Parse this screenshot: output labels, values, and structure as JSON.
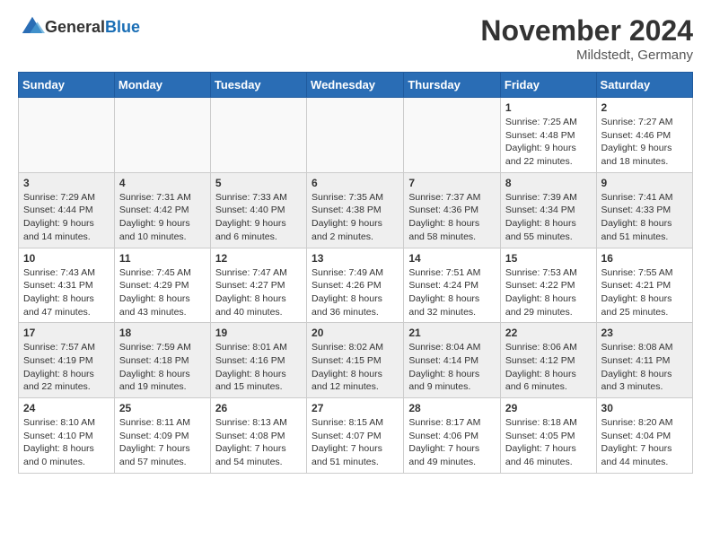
{
  "logo": {
    "general": "General",
    "blue": "Blue"
  },
  "title": "November 2024",
  "subtitle": "Mildstedt, Germany",
  "headers": [
    "Sunday",
    "Monday",
    "Tuesday",
    "Wednesday",
    "Thursday",
    "Friday",
    "Saturday"
  ],
  "weeks": [
    {
      "days": [
        {
          "num": "",
          "info": ""
        },
        {
          "num": "",
          "info": ""
        },
        {
          "num": "",
          "info": ""
        },
        {
          "num": "",
          "info": ""
        },
        {
          "num": "",
          "info": ""
        },
        {
          "num": "1",
          "info": "Sunrise: 7:25 AM\nSunset: 4:48 PM\nDaylight: 9 hours\nand 22 minutes."
        },
        {
          "num": "2",
          "info": "Sunrise: 7:27 AM\nSunset: 4:46 PM\nDaylight: 9 hours\nand 18 minutes."
        }
      ]
    },
    {
      "days": [
        {
          "num": "3",
          "info": "Sunrise: 7:29 AM\nSunset: 4:44 PM\nDaylight: 9 hours\nand 14 minutes."
        },
        {
          "num": "4",
          "info": "Sunrise: 7:31 AM\nSunset: 4:42 PM\nDaylight: 9 hours\nand 10 minutes."
        },
        {
          "num": "5",
          "info": "Sunrise: 7:33 AM\nSunset: 4:40 PM\nDaylight: 9 hours\nand 6 minutes."
        },
        {
          "num": "6",
          "info": "Sunrise: 7:35 AM\nSunset: 4:38 PM\nDaylight: 9 hours\nand 2 minutes."
        },
        {
          "num": "7",
          "info": "Sunrise: 7:37 AM\nSunset: 4:36 PM\nDaylight: 8 hours\nand 58 minutes."
        },
        {
          "num": "8",
          "info": "Sunrise: 7:39 AM\nSunset: 4:34 PM\nDaylight: 8 hours\nand 55 minutes."
        },
        {
          "num": "9",
          "info": "Sunrise: 7:41 AM\nSunset: 4:33 PM\nDaylight: 8 hours\nand 51 minutes."
        }
      ]
    },
    {
      "days": [
        {
          "num": "10",
          "info": "Sunrise: 7:43 AM\nSunset: 4:31 PM\nDaylight: 8 hours\nand 47 minutes."
        },
        {
          "num": "11",
          "info": "Sunrise: 7:45 AM\nSunset: 4:29 PM\nDaylight: 8 hours\nand 43 minutes."
        },
        {
          "num": "12",
          "info": "Sunrise: 7:47 AM\nSunset: 4:27 PM\nDaylight: 8 hours\nand 40 minutes."
        },
        {
          "num": "13",
          "info": "Sunrise: 7:49 AM\nSunset: 4:26 PM\nDaylight: 8 hours\nand 36 minutes."
        },
        {
          "num": "14",
          "info": "Sunrise: 7:51 AM\nSunset: 4:24 PM\nDaylight: 8 hours\nand 32 minutes."
        },
        {
          "num": "15",
          "info": "Sunrise: 7:53 AM\nSunset: 4:22 PM\nDaylight: 8 hours\nand 29 minutes."
        },
        {
          "num": "16",
          "info": "Sunrise: 7:55 AM\nSunset: 4:21 PM\nDaylight: 8 hours\nand 25 minutes."
        }
      ]
    },
    {
      "days": [
        {
          "num": "17",
          "info": "Sunrise: 7:57 AM\nSunset: 4:19 PM\nDaylight: 8 hours\nand 22 minutes."
        },
        {
          "num": "18",
          "info": "Sunrise: 7:59 AM\nSunset: 4:18 PM\nDaylight: 8 hours\nand 19 minutes."
        },
        {
          "num": "19",
          "info": "Sunrise: 8:01 AM\nSunset: 4:16 PM\nDaylight: 8 hours\nand 15 minutes."
        },
        {
          "num": "20",
          "info": "Sunrise: 8:02 AM\nSunset: 4:15 PM\nDaylight: 8 hours\nand 12 minutes."
        },
        {
          "num": "21",
          "info": "Sunrise: 8:04 AM\nSunset: 4:14 PM\nDaylight: 8 hours\nand 9 minutes."
        },
        {
          "num": "22",
          "info": "Sunrise: 8:06 AM\nSunset: 4:12 PM\nDaylight: 8 hours\nand 6 minutes."
        },
        {
          "num": "23",
          "info": "Sunrise: 8:08 AM\nSunset: 4:11 PM\nDaylight: 8 hours\nand 3 minutes."
        }
      ]
    },
    {
      "days": [
        {
          "num": "24",
          "info": "Sunrise: 8:10 AM\nSunset: 4:10 PM\nDaylight: 8 hours\nand 0 minutes."
        },
        {
          "num": "25",
          "info": "Sunrise: 8:11 AM\nSunset: 4:09 PM\nDaylight: 7 hours\nand 57 minutes."
        },
        {
          "num": "26",
          "info": "Sunrise: 8:13 AM\nSunset: 4:08 PM\nDaylight: 7 hours\nand 54 minutes."
        },
        {
          "num": "27",
          "info": "Sunrise: 8:15 AM\nSunset: 4:07 PM\nDaylight: 7 hours\nand 51 minutes."
        },
        {
          "num": "28",
          "info": "Sunrise: 8:17 AM\nSunset: 4:06 PM\nDaylight: 7 hours\nand 49 minutes."
        },
        {
          "num": "29",
          "info": "Sunrise: 8:18 AM\nSunset: 4:05 PM\nDaylight: 7 hours\nand 46 minutes."
        },
        {
          "num": "30",
          "info": "Sunrise: 8:20 AM\nSunset: 4:04 PM\nDaylight: 7 hours\nand 44 minutes."
        }
      ]
    }
  ]
}
